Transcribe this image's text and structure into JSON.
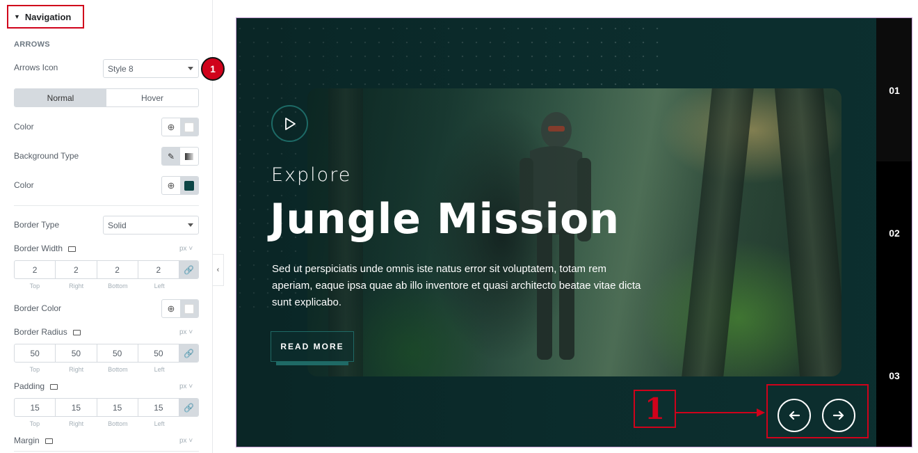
{
  "panel": {
    "section_title": "Navigation",
    "subsection_title": "ARROWS",
    "arrows_icon": {
      "label": "Arrows Icon",
      "value": "Style 8",
      "badge": "1"
    },
    "state_tabs": [
      {
        "label": "Normal",
        "active": true
      },
      {
        "label": "Hover",
        "active": false
      }
    ],
    "color1": {
      "label": "Color",
      "swatch": "#ffffff"
    },
    "background_type": {
      "label": "Background Type"
    },
    "color2": {
      "label": "Color",
      "swatch": "#0c4545"
    },
    "border_type": {
      "label": "Border Type",
      "value": "Solid"
    },
    "border_width": {
      "label": "Border Width",
      "unit": "px",
      "values": [
        "2",
        "2",
        "2",
        "2"
      ]
    },
    "border_color": {
      "label": "Border Color",
      "swatch": "#ffffff"
    },
    "border_radius": {
      "label": "Border Radius",
      "unit": "px",
      "values": [
        "50",
        "50",
        "50",
        "50"
      ]
    },
    "padding": {
      "label": "Padding",
      "unit": "px",
      "values": [
        "15",
        "15",
        "15",
        "15"
      ]
    },
    "margin": {
      "label": "Margin",
      "unit": "px"
    },
    "dimension_labels": [
      "Top",
      "Right",
      "Bottom",
      "Left"
    ]
  },
  "preview": {
    "subtitle": "Explore",
    "title": "Jungle Mission",
    "description": "Sed ut perspiciatis unde omnis iste natus error sit voluptatem, totam rem aperiam, eaque ipsa quae ab illo inventore et quasi architecto beatae vitae dicta sunt explicabo.",
    "button_label": "READ MORE",
    "slide_numbers": [
      "01",
      "02",
      "03"
    ],
    "callout_label": "1",
    "accent_color": "#1f6a66",
    "background_color": "#0c2f2f"
  }
}
